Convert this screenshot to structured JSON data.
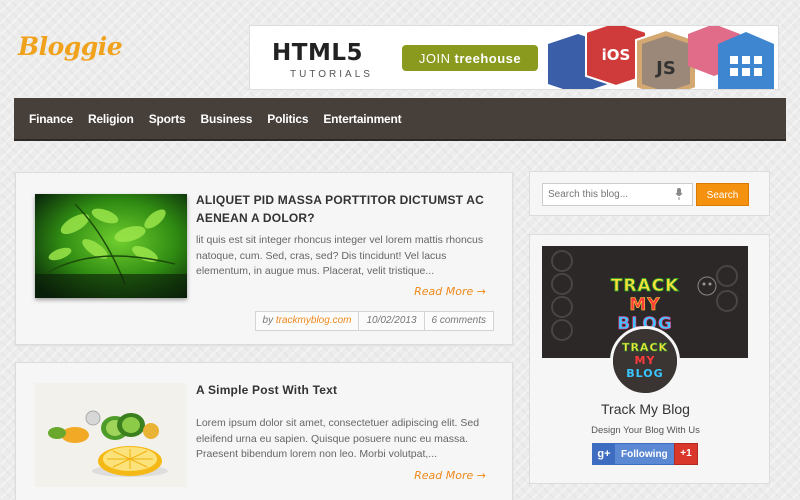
{
  "header": {
    "logo": "Bloggie"
  },
  "banner": {
    "title": "HTML5",
    "subtitle": "TUTORIALS",
    "cta_prefix": "JOIN",
    "cta_brand": "treehouse",
    "badges": [
      "iOS",
      "JS"
    ]
  },
  "nav": {
    "items": [
      "Finance",
      "Religion",
      "Sports",
      "Business",
      "Politics",
      "Entertainment"
    ]
  },
  "posts": [
    {
      "title": "ALIQUET PID MASSA PORTTITOR DICTUMST AC AENEAN A DOLOR?",
      "excerpt": "lit quis est sit integer rhoncus integer vel lorem mattis rhoncus natoque, cum. Sed, cras, sed? Dis tincidunt! Vel lacus elementum, in augue mus. Placerat, velit tristique...",
      "read_more": "Read More →",
      "meta": {
        "by": "by",
        "author": "trackmyblog.com",
        "date": "10/02/2013",
        "comments": "6 comments"
      }
    },
    {
      "title": "A Simple Post With Text",
      "excerpt": "Lorem ipsum dolor sit amet, consectetuer adipiscing elit. Sed eleifend urna eu sapien. Quisque posuere nunc eu massa. Praesent bibendum lorem non leo. Morbi volutpat,...",
      "read_more": "Read More →"
    }
  ],
  "sidebar": {
    "search": {
      "placeholder": "Search this blog...",
      "button": "Search"
    },
    "widget": {
      "cover_text": [
        "TRACK",
        "MY",
        "BLOG"
      ],
      "blog_name": "Track My Blog",
      "description": "Design Your Blog With Us",
      "follow_label": "Following",
      "g_label": "g+",
      "plus_one": "+1"
    }
  },
  "colors": {
    "accent": "#f0a21c",
    "nav_bg": "#463f3a",
    "search_button": "#f4910f",
    "read_more": "#f0891c",
    "gplus": "#5a88d3",
    "plus_one": "#d8372a"
  }
}
